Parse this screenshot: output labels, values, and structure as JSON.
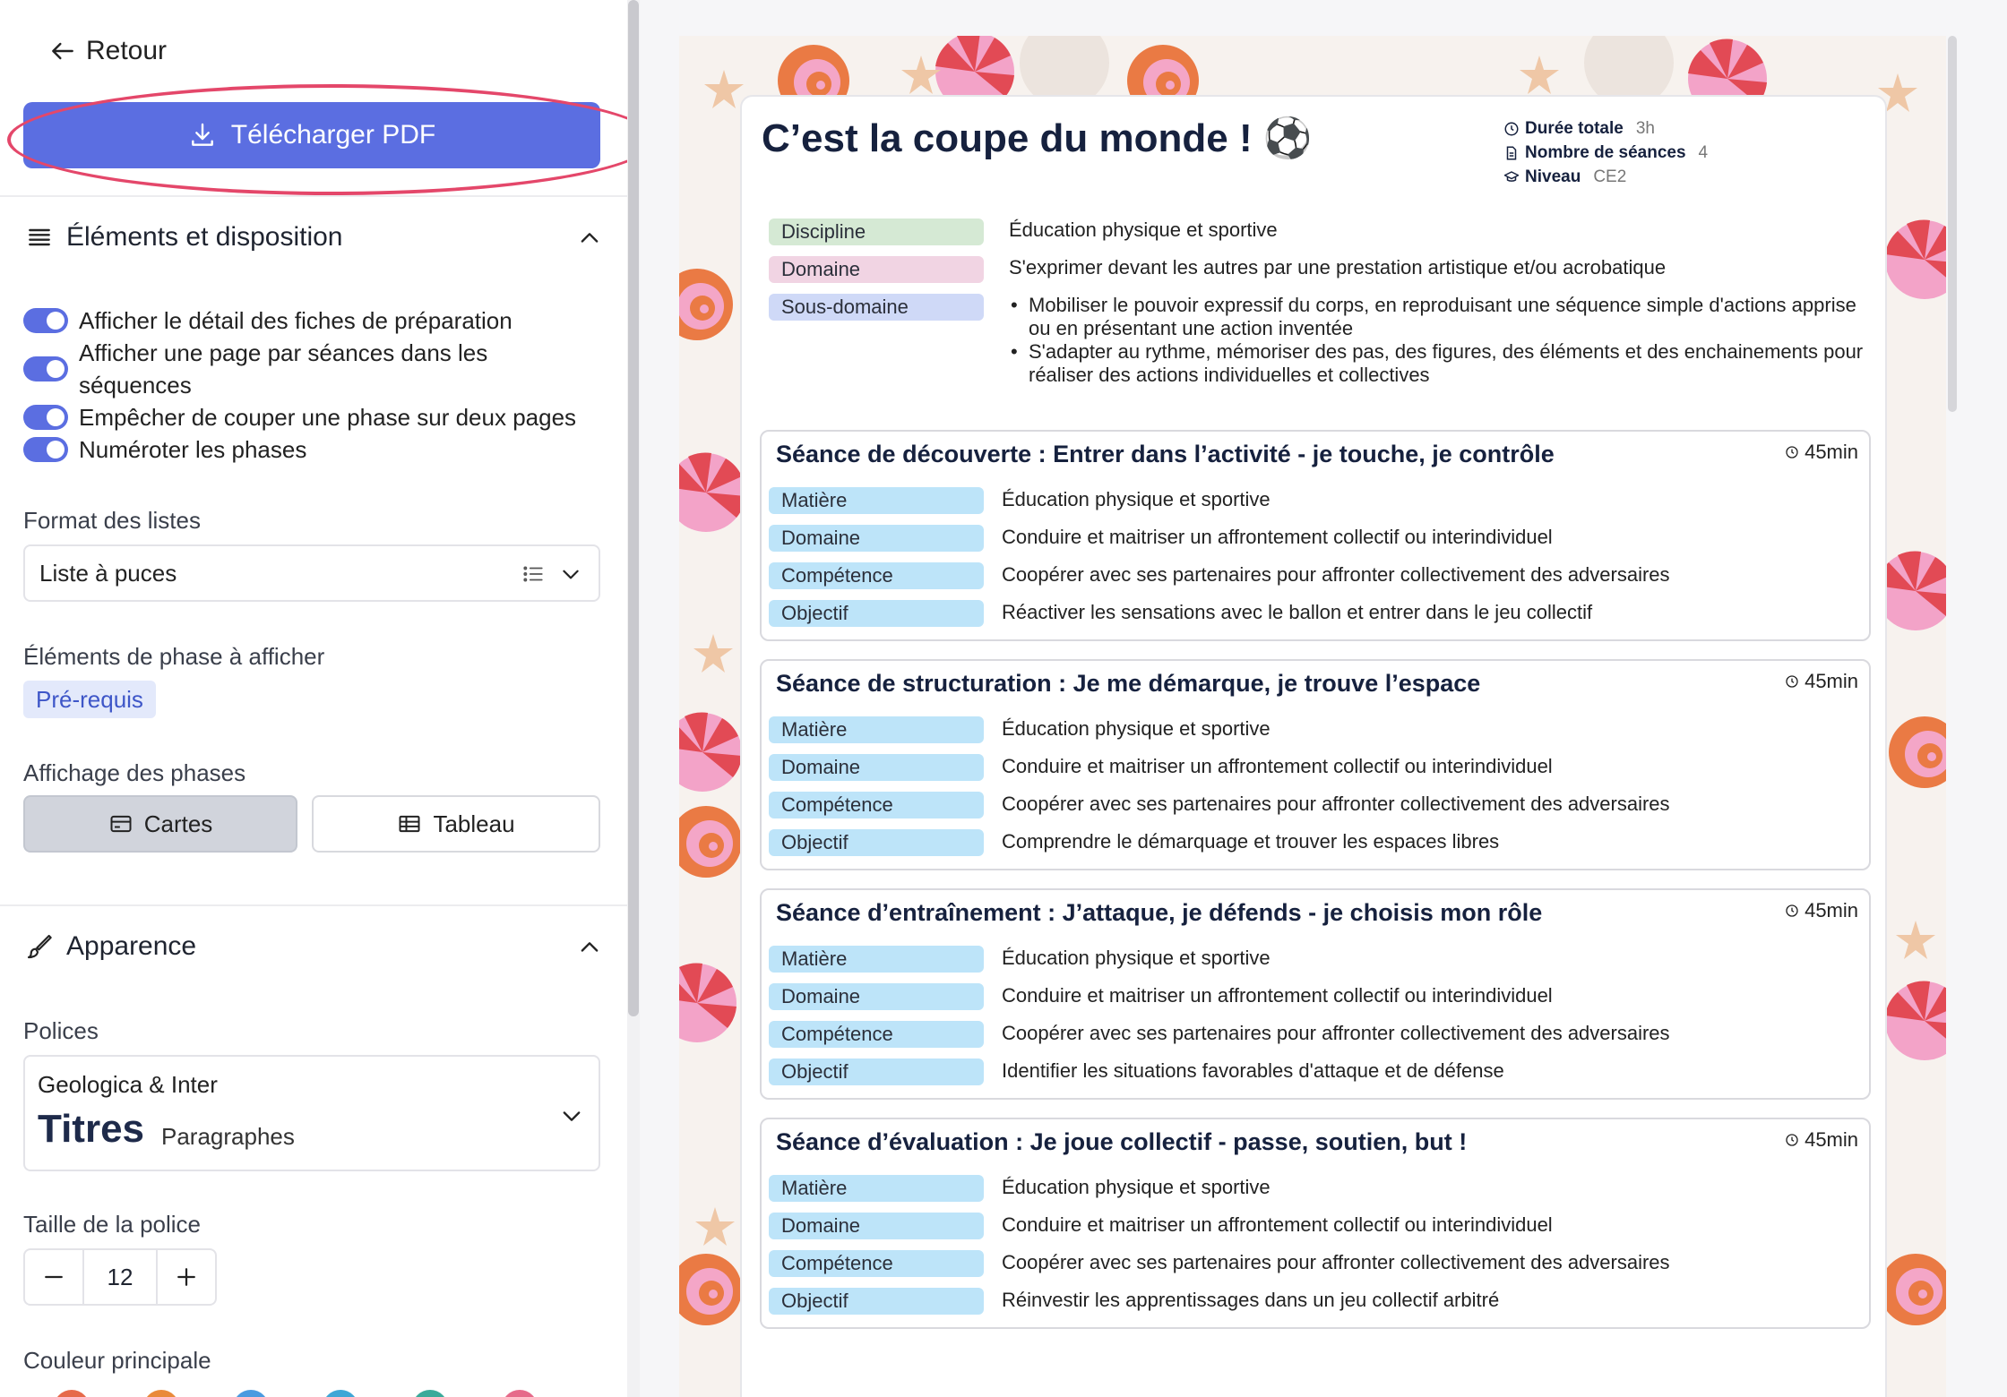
{
  "sidebar": {
    "back_label": "Retour",
    "download_label": "Télécharger PDF",
    "section_layout_title": "Éléments et disposition",
    "toggles": [
      {
        "label": "Afficher le détail des fiches de préparation",
        "on": true
      },
      {
        "label": "Afficher une page par séances dans les séquences",
        "on": true
      },
      {
        "label": "Empêcher de couper une phase sur deux pages",
        "on": true
      },
      {
        "label": "Numéroter les phases",
        "on": true
      }
    ],
    "list_format_label": "Format des listes",
    "list_format_value": "Liste à puces",
    "phase_elements_label": "Éléments de phase à afficher",
    "phase_elements_chip": "Pré-requis",
    "phase_display_label": "Affichage des phases",
    "phase_display_options": [
      "Cartes",
      "Tableau"
    ],
    "phase_display_selected": "Cartes",
    "section_appearance_title": "Apparence",
    "fonts_label": "Polices",
    "fonts_value": "Geologica & Inter",
    "fonts_titles_sample": "Titres",
    "fonts_paragraphs_sample": "Paragraphes",
    "font_size_label": "Taille de la police",
    "font_size_value": "12",
    "main_color_label": "Couleur principale",
    "colors": [
      "#e66a4a",
      "#e98a3a",
      "#4a9be0",
      "#3fa7d6",
      "#3aaa9a",
      "#e66a8a"
    ]
  },
  "document": {
    "title": "C’est la coupe du monde ! ⚽",
    "meta": {
      "duration_label": "Durée totale",
      "duration_value": "3h",
      "sessions_label": "Nombre de séances",
      "sessions_value": "4",
      "level_label": "Niveau",
      "level_value": "CE2"
    },
    "info": {
      "discipline_label": "Discipline",
      "discipline_value": "Éducation physique et sportive",
      "domain_label": "Domaine",
      "domain_value": "S'exprimer devant les autres par une prestation artistique et/ou acrobatique",
      "subdomain_label": "Sous-domaine",
      "subdomain_values": [
        "Mobiliser le pouvoir expressif du corps, en reproduisant une séquence simple d'actions apprise ou en présentant une action inventée",
        "S'adapter au rythme, mémoriser des pas, des figures, des éléments et des enchainements pour réaliser des actions individuelles et collectives"
      ]
    },
    "row_labels": {
      "subject": "Matière",
      "domain": "Domaine",
      "competence": "Compétence",
      "objective": "Objectif"
    },
    "seances": [
      {
        "title": "Séance de découverte : Entrer dans l’activité - je touche, je contrôle",
        "duration": "45min",
        "subject": "Éducation physique et sportive",
        "domain": "Conduire et maitriser un affrontement collectif ou interindividuel",
        "competence": "Coopérer avec ses partenaires pour affronter collectivement des adversaires",
        "objective": "Réactiver les sensations avec le ballon et entrer dans le jeu collectif"
      },
      {
        "title": "Séance de structuration : Je me démarque, je trouve l’espace",
        "duration": "45min",
        "subject": "Éducation physique et sportive",
        "domain": "Conduire et maitriser un affrontement collectif ou interindividuel",
        "competence": "Coopérer avec ses partenaires pour affronter collectivement des adversaires",
        "objective": "Comprendre le démarquage et trouver les espaces libres"
      },
      {
        "title": "Séance d’entraînement : J’attaque, je défends - je choisis mon rôle",
        "duration": "45min",
        "subject": "Éducation physique et sportive",
        "domain": "Conduire et maitriser un affrontement collectif ou interindividuel",
        "competence": "Coopérer avec ses partenaires pour affronter collectivement des adversaires",
        "objective": "Identifier les situations favorables d'attaque et de défense"
      },
      {
        "title": "Séance d’évaluation : Je joue collectif - passe, soutien, but !",
        "duration": "45min",
        "subject": "Éducation physique et sportive",
        "domain": "Conduire et maitriser un affrontement collectif ou interindividuel",
        "competence": "Coopérer avec ses partenaires pour affronter collectivement des adversaires",
        "objective": "Réinvestir les apprentissages dans un jeu collectif arbitré"
      }
    ]
  }
}
